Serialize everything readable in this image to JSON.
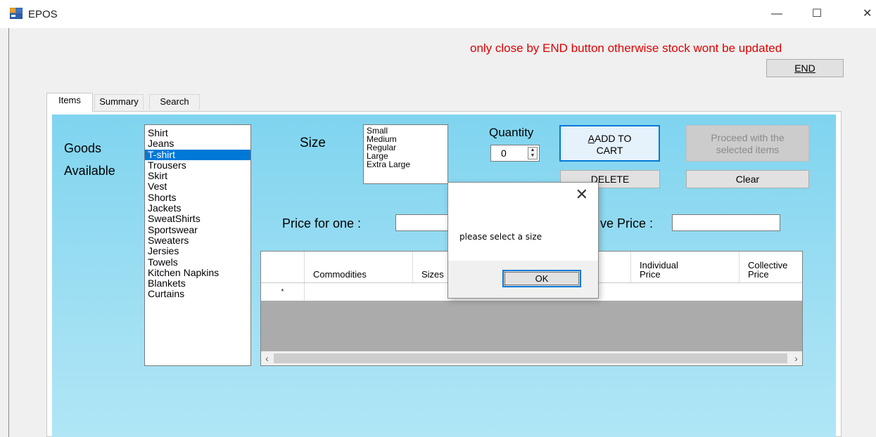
{
  "window": {
    "title": "EPOS",
    "minimize_glyph": "—",
    "maximize_glyph": "☐",
    "close_glyph": "✕"
  },
  "warning_text": "only close by END button otherwise stock wont be updated",
  "end_button": {
    "label": "END"
  },
  "tabs": [
    {
      "label": "Items",
      "active": true
    },
    {
      "label": "Summary",
      "active": false
    },
    {
      "label": "Search",
      "active": false
    }
  ],
  "goods": {
    "label_line1": "Goods",
    "label_line2": "Available",
    "items": [
      "Shirt",
      "Jeans",
      "T-shirt",
      "Trousers",
      "Skirt",
      "Vest",
      "Shorts",
      "Jackets",
      "SweatShirts",
      "Sportswear",
      "Sweaters",
      "Jersies",
      "Towels",
      "Kitchen Napkins",
      "Blankets",
      "Curtains"
    ],
    "selected": "T-shirt"
  },
  "size": {
    "label": "Size",
    "options": [
      "Small",
      "Medium",
      "Regular",
      "Large",
      "Extra Large"
    ]
  },
  "quantity": {
    "label": "Quantity",
    "value": "0"
  },
  "buttons": {
    "add_to_cart_line1": "ADD TO",
    "add_to_cart_line2": "CART",
    "delete": "DELETE",
    "proceed_line1": "Proceed with the",
    "proceed_line2": "selected items",
    "clear": "Clear"
  },
  "price_for_one_label": "Price for one :",
  "collective_price_label": "ve Price :",
  "grid": {
    "columns": [
      "Commodities",
      "Sizes",
      "Individual Price",
      "Collective Price"
    ],
    "new_row_marker": "*"
  },
  "dialog": {
    "message": "please select a size",
    "ok_label": "OK",
    "close_glyph": "✕"
  },
  "colors": {
    "warning": "#e00000",
    "accent": "#0078d7",
    "panel_gradient_top": "#7fd4ef",
    "panel_gradient_bottom": "#b0e6f6"
  }
}
